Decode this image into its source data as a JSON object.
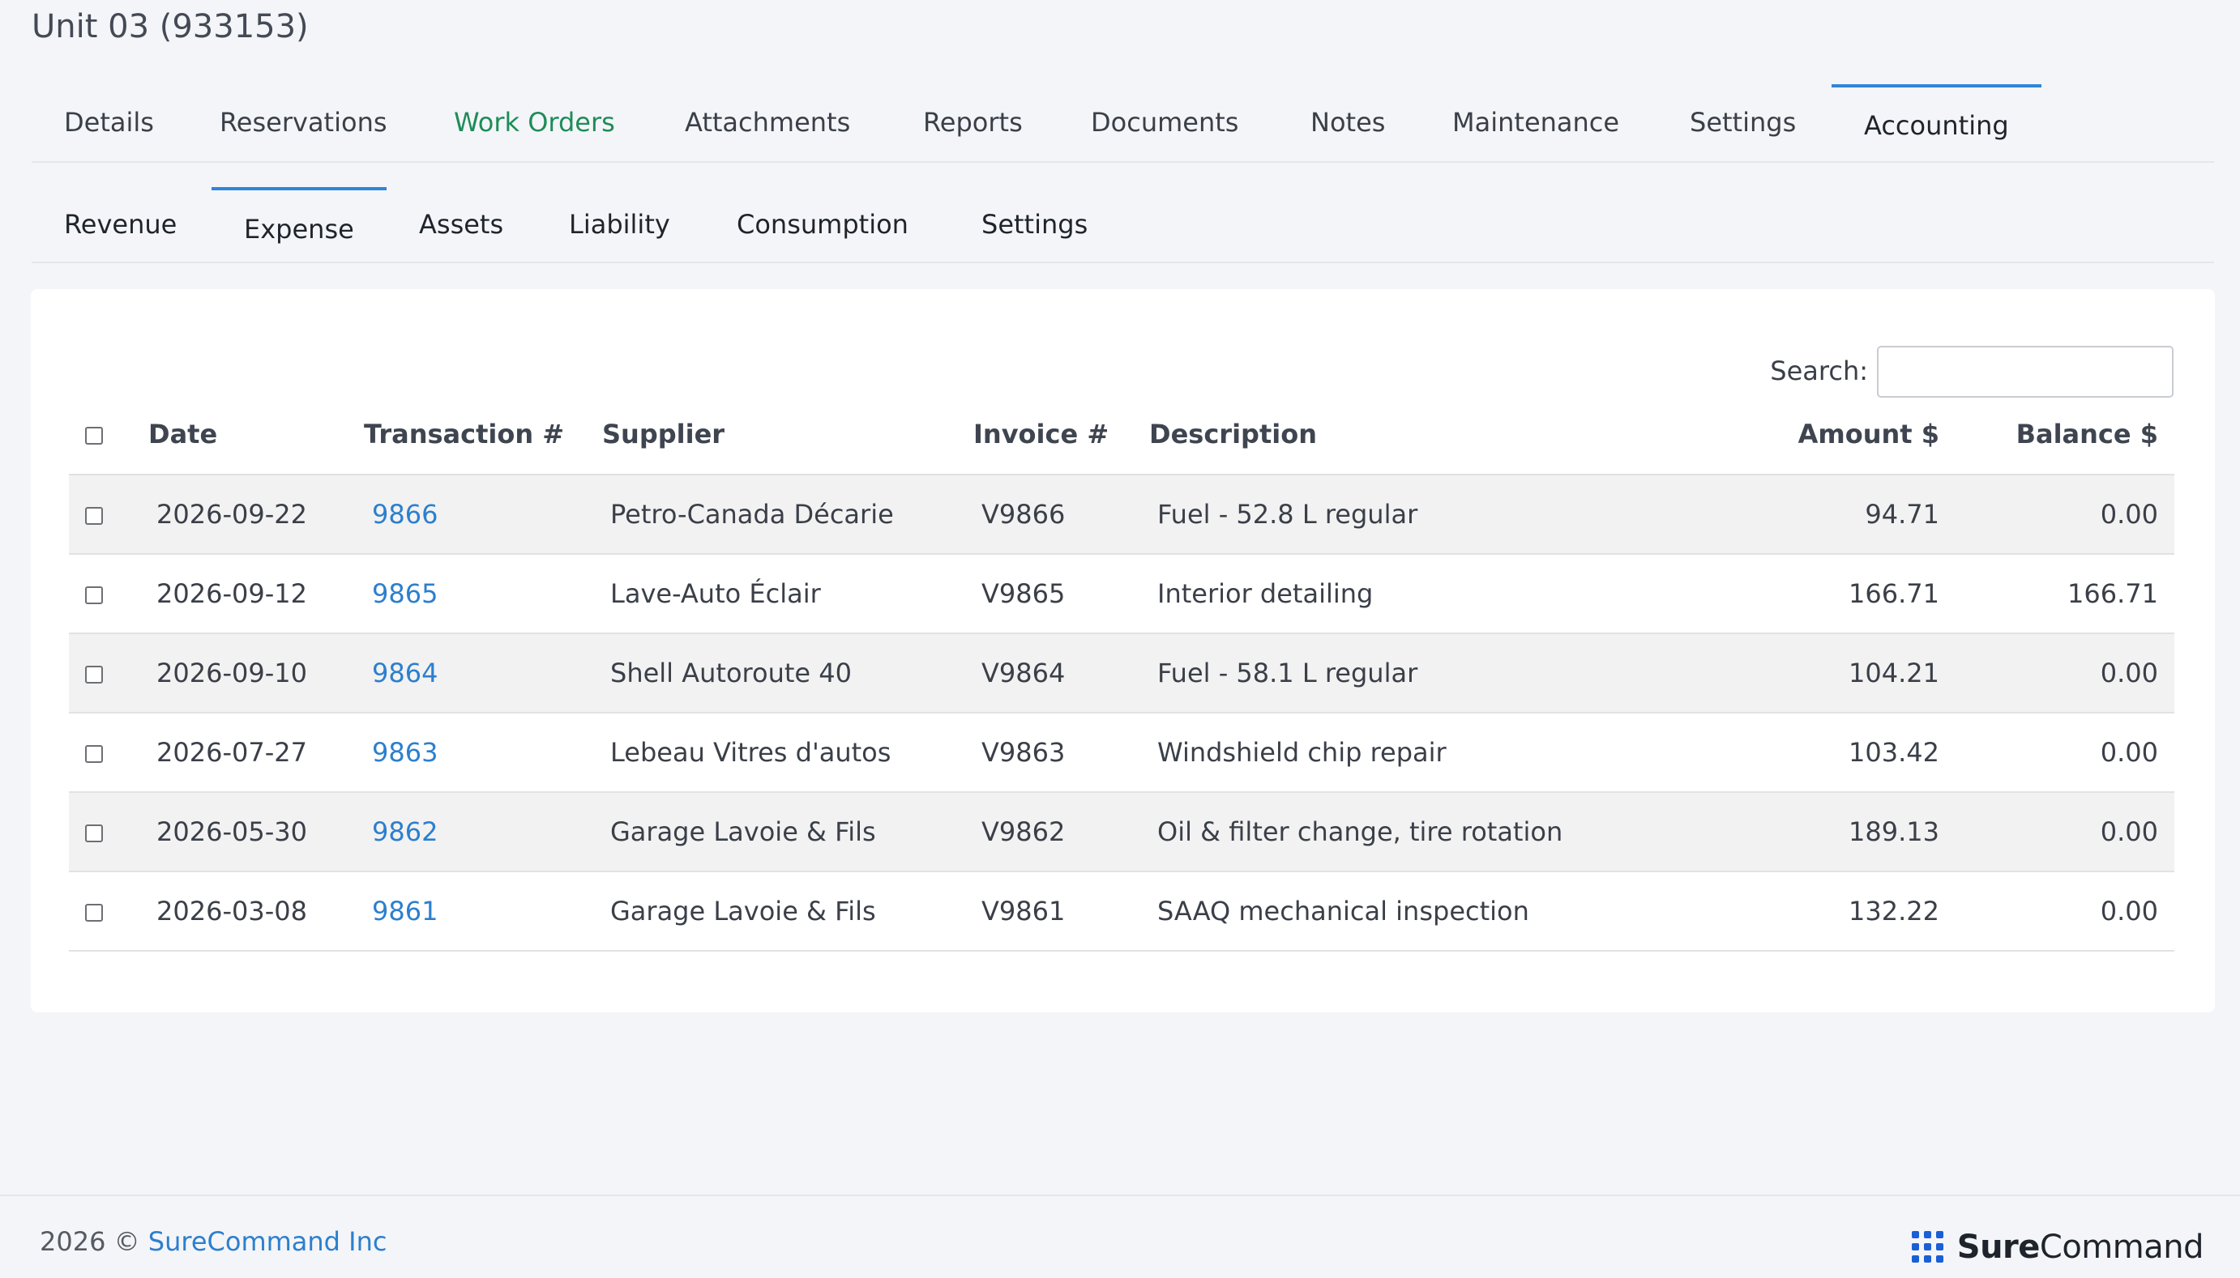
{
  "header": {
    "title": "Unit 03 (933153)"
  },
  "main_tabs": [
    {
      "label": "Details"
    },
    {
      "label": "Reservations"
    },
    {
      "label": "Work Orders"
    },
    {
      "label": "Attachments"
    },
    {
      "label": "Reports"
    },
    {
      "label": "Documents"
    },
    {
      "label": "Notes"
    },
    {
      "label": "Maintenance"
    },
    {
      "label": "Settings"
    },
    {
      "label": "Accounting"
    }
  ],
  "sub_tabs": [
    {
      "label": "Revenue"
    },
    {
      "label": "Expense"
    },
    {
      "label": "Assets"
    },
    {
      "label": "Liability"
    },
    {
      "label": "Consumption"
    },
    {
      "label": "Settings"
    }
  ],
  "search": {
    "label": "Search:",
    "value": ""
  },
  "table": {
    "headers": {
      "date": "Date",
      "transaction": "Transaction #",
      "supplier": "Supplier",
      "invoice": "Invoice #",
      "description": "Description",
      "amount": "Amount $",
      "balance": "Balance $"
    },
    "rows": [
      {
        "date": "2026-09-22",
        "transaction": "9866",
        "supplier": "Petro-Canada Décarie",
        "invoice": "V9866",
        "description": "Fuel - 52.8 L regular",
        "amount": "94.71",
        "balance": "0.00"
      },
      {
        "date": "2026-09-12",
        "transaction": "9865",
        "supplier": "Lave-Auto Éclair",
        "invoice": "V9865",
        "description": "Interior detailing",
        "amount": "166.71",
        "balance": "166.71"
      },
      {
        "date": "2026-09-10",
        "transaction": "9864",
        "supplier": "Shell Autoroute 40",
        "invoice": "V9864",
        "description": "Fuel - 58.1 L regular",
        "amount": "104.21",
        "balance": "0.00"
      },
      {
        "date": "2026-07-27",
        "transaction": "9863",
        "supplier": "Lebeau Vitres d'autos",
        "invoice": "V9863",
        "description": "Windshield chip repair",
        "amount": "103.42",
        "balance": "0.00"
      },
      {
        "date": "2026-05-30",
        "transaction": "9862",
        "supplier": "Garage Lavoie & Fils",
        "invoice": "V9862",
        "description": "Oil & filter change, tire rotation",
        "amount": "189.13",
        "balance": "0.00"
      },
      {
        "date": "2026-03-08",
        "transaction": "9861",
        "supplier": "Garage Lavoie & Fils",
        "invoice": "V9861",
        "description": "SAAQ mechanical inspection",
        "amount": "132.22",
        "balance": "0.00"
      }
    ]
  },
  "footer": {
    "copyright": "2026 ©",
    "company": "SureCommand Inc",
    "brand_bold": "Sure",
    "brand_light": "Command",
    "brand_icon": "grid-dots-icon"
  },
  "colors": {
    "link": "#2c7fce",
    "active_tab_border": "#2f86d8",
    "work_orders_tab": "#1e8c5a",
    "brand_icon": "#1a5fd6"
  }
}
